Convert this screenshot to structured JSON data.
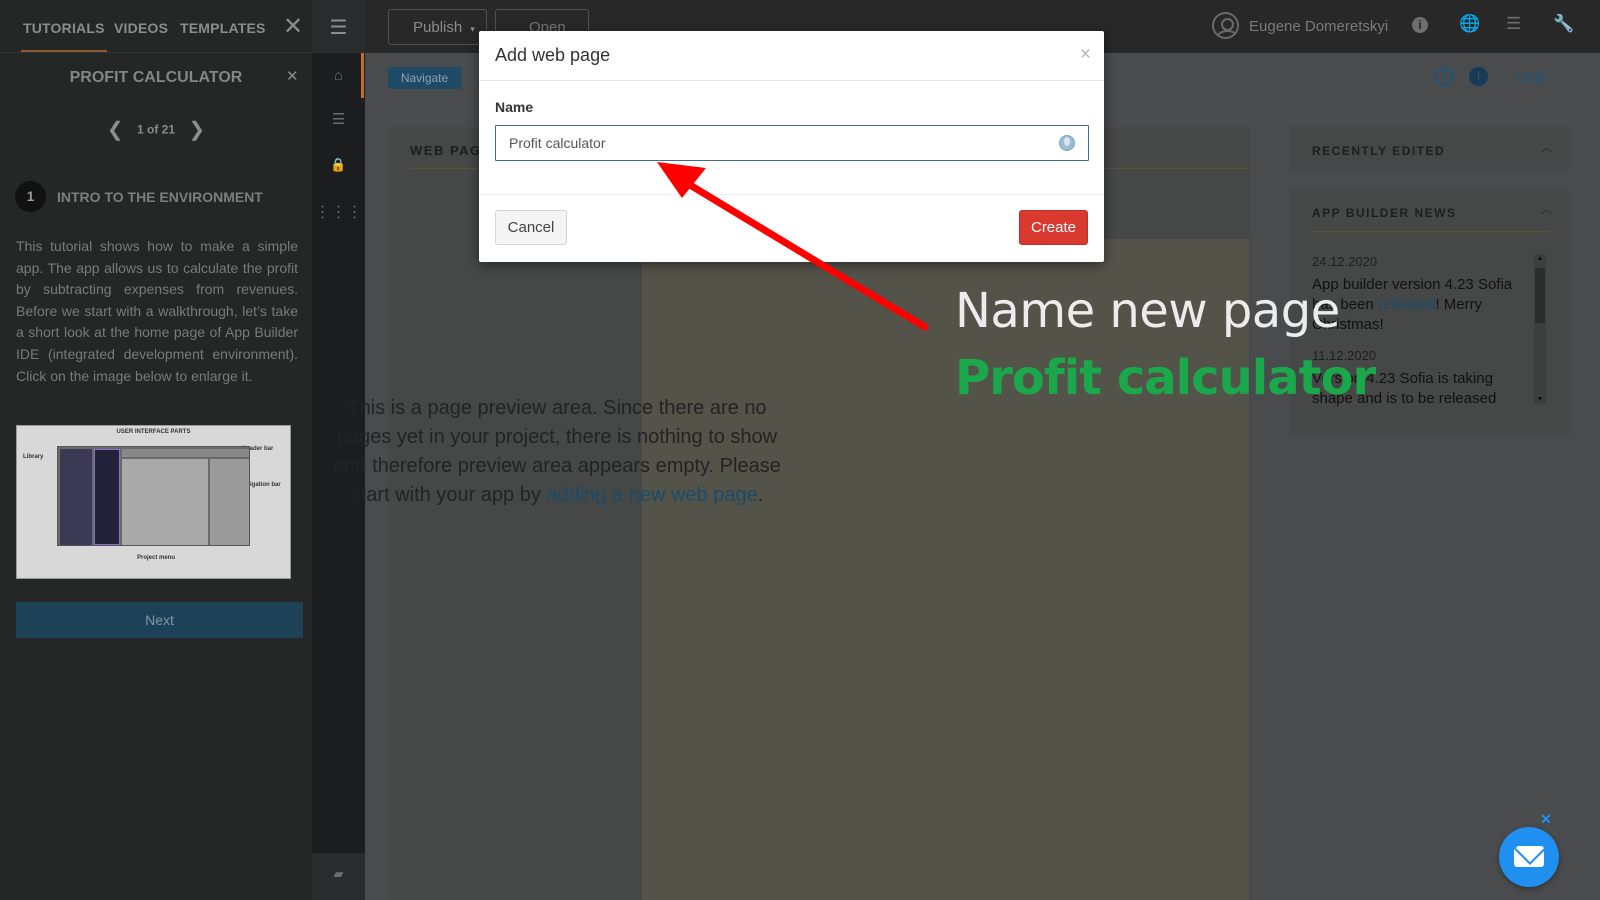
{
  "tutorial_panel": {
    "tabs": [
      "TUTORIALS",
      "VIDEOS",
      "TEMPLATES"
    ],
    "close_label": "✕",
    "title": "PROFIT CALCULATOR",
    "title_close": "✕",
    "pager": {
      "text": "1 of 21",
      "prev": "❮",
      "next": "❯"
    },
    "step": {
      "number": "1",
      "title": "INTRO TO THE ENVIRONMENT"
    },
    "body": "This tutorial shows how to make a simple app. The app allows us to calculate the profit by subtracting expenses from revenues. Before we start with a walkthrough, let’s take a short look at the home page of  App Builder IDE (integrated development environment). Click on the image below to enlarge it.",
    "image": {
      "title": "USER INTERFACE PARTS",
      "labels": {
        "library": "Library",
        "header_bar": "Header bar",
        "navigation_bar": "Navigation bar",
        "project_menu": "Project menu"
      }
    },
    "next_button": "Next"
  },
  "icon_rail": {
    "menu_icon": "☰",
    "home_icon": "⌂",
    "list_icon": "☰",
    "lock_icon": "🔒",
    "grid_icon": "⋮⋮⋮",
    "book_icon": "▰"
  },
  "topbar": {
    "publish_label": "Publish",
    "publish_caret": "▾",
    "open_label": "Open",
    "user_name": "Eugene Domeretskyi",
    "info_icon": "i",
    "globe_icon": "🌐",
    "list_icon": "☰",
    "wrench_icon": "🔧"
  },
  "subbar": {
    "navigate_label": "Navigate",
    "help_icon": "?",
    "badge_icon": "!",
    "help_label": "Help"
  },
  "pages_panel": {
    "title": "WEB PAGES",
    "preview_text": "This is a page preview area. Since there are no pages yet in your project, there is nothing to show and therefore preview area appears empty. Please start with your app by ",
    "preview_link": "adding a new web page",
    "preview_end": "."
  },
  "recent_panel": {
    "title": "RECENTLY EDITED",
    "chevron": "︿"
  },
  "news_panel": {
    "title": "APP BUILDER NEWS",
    "chevron": "︿",
    "items": [
      {
        "date": "24.12.2020",
        "text_before": "App builder version 4.23 Sofia has been ",
        "link": "released",
        "text_after": "! Merry Christmas!"
      },
      {
        "date": "11.12.2020",
        "text": "Version 4.23 Sofia is taking shape and is to be released"
      }
    ],
    "scroll_up": "▲",
    "scroll_down": "▼"
  },
  "modal": {
    "title": "Add web page",
    "close_label": "×",
    "name_label": "Name",
    "name_value": "Profit calculator",
    "cancel_label": "Cancel",
    "create_label": "Create"
  },
  "annotation": {
    "line1": "Name new page",
    "line2": "Profit calculator",
    "arrow_color": "#ff0000",
    "line1_color": "#ececec",
    "line2_color": "#1aa84b"
  },
  "chat": {
    "close_label": "✕"
  },
  "colors": {
    "accent_orange": "#c86f2c",
    "create_red": "#d9392f",
    "chat_blue": "#1f8ff0",
    "navigate_blue": "#1f4a66"
  }
}
